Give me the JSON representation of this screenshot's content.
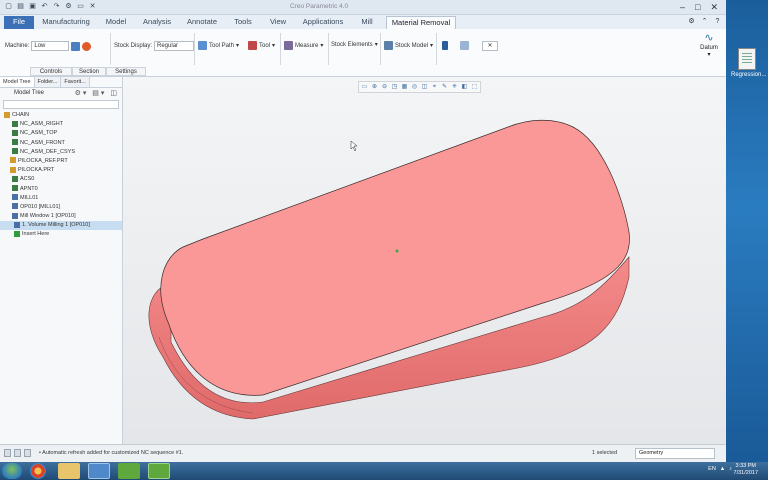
{
  "window": {
    "title": "Creo Parametric 4.0",
    "quick_access_icons": [
      "new-icon",
      "open-icon",
      "save-icon",
      "undo-icon",
      "redo-icon",
      "regenerate-icon",
      "windows-icon",
      "close-icon"
    ]
  },
  "tabs": [
    "File",
    "Manufacturing",
    "Model",
    "Analysis",
    "Annotate",
    "Tools",
    "View",
    "Applications",
    "Mill",
    "Material Removal"
  ],
  "active_tab": "Material Removal",
  "ribbon": {
    "machine_label": "Machine:",
    "machine_value": "Low",
    "stock_display_label": "Stock Display:",
    "stock_display_value": "Regular",
    "tool_path": "Tool Path",
    "tool": "Tool",
    "measure": "Measure",
    "stock_elements": "Stock Elements",
    "stock_model": "Stock Model",
    "datum": "Datum",
    "subtabs": [
      "Controls",
      "Section",
      "Settings"
    ]
  },
  "panel": {
    "tabs": [
      "Model Tree",
      "Folder...",
      "Favorit..."
    ],
    "header": "Model Tree",
    "tree": [
      {
        "label": "CHAIN",
        "icon": "assembly-icon",
        "color": "#d39b2e"
      },
      {
        "label": "NC_ASM_RIGHT",
        "icon": "datum-plane-icon",
        "color": "#3a7d44"
      },
      {
        "label": "NC_ASM_TOP",
        "icon": "datum-plane-icon",
        "color": "#3a7d44"
      },
      {
        "label": "NC_ASM_FRONT",
        "icon": "datum-plane-icon",
        "color": "#3a7d44"
      },
      {
        "label": "NC_ASM_DEF_CSYS",
        "icon": "csys-icon",
        "color": "#3a7d44"
      },
      {
        "label": "PILOCKA_REF.PRT",
        "icon": "part-icon",
        "color": "#d39b2e"
      },
      {
        "label": "PILOCKA.PRT",
        "icon": "part-icon",
        "color": "#d39b2e"
      },
      {
        "label": "ACS0",
        "icon": "csys-icon",
        "color": "#3a7d44"
      },
      {
        "label": "APNT0",
        "icon": "datum-point-icon",
        "color": "#3a7d44"
      },
      {
        "label": "MILL01",
        "icon": "workcenter-icon",
        "color": "#4a6fa5"
      },
      {
        "label": "OP010 [MILL01]",
        "icon": "operation-icon",
        "color": "#4a6fa5"
      },
      {
        "label": "Mill Window 1 [OP010]",
        "icon": "mill-window-icon",
        "color": "#4a6fa5"
      },
      {
        "label": "1. Volume Milling 1 [OP010]",
        "icon": "sequence-icon",
        "color": "#4a6fa5"
      },
      {
        "label": "Insert Here",
        "icon": "insert-arrow-icon",
        "color": "#2f9e3a"
      }
    ],
    "selected_index": 12
  },
  "status": {
    "message": "• Automatic refresh added for customized NC sequence #1.",
    "selected": "1 selected",
    "filter": "Geometry"
  },
  "desktop_icon_label": "Regression...",
  "clock": {
    "time": "3:33 PM",
    "date": "7/31/2017"
  },
  "colors": {
    "model_face": "#fa9797",
    "model_side": "#f27878",
    "ribbon_file": "#3b6fb6",
    "selection": "#c7ddf2"
  }
}
